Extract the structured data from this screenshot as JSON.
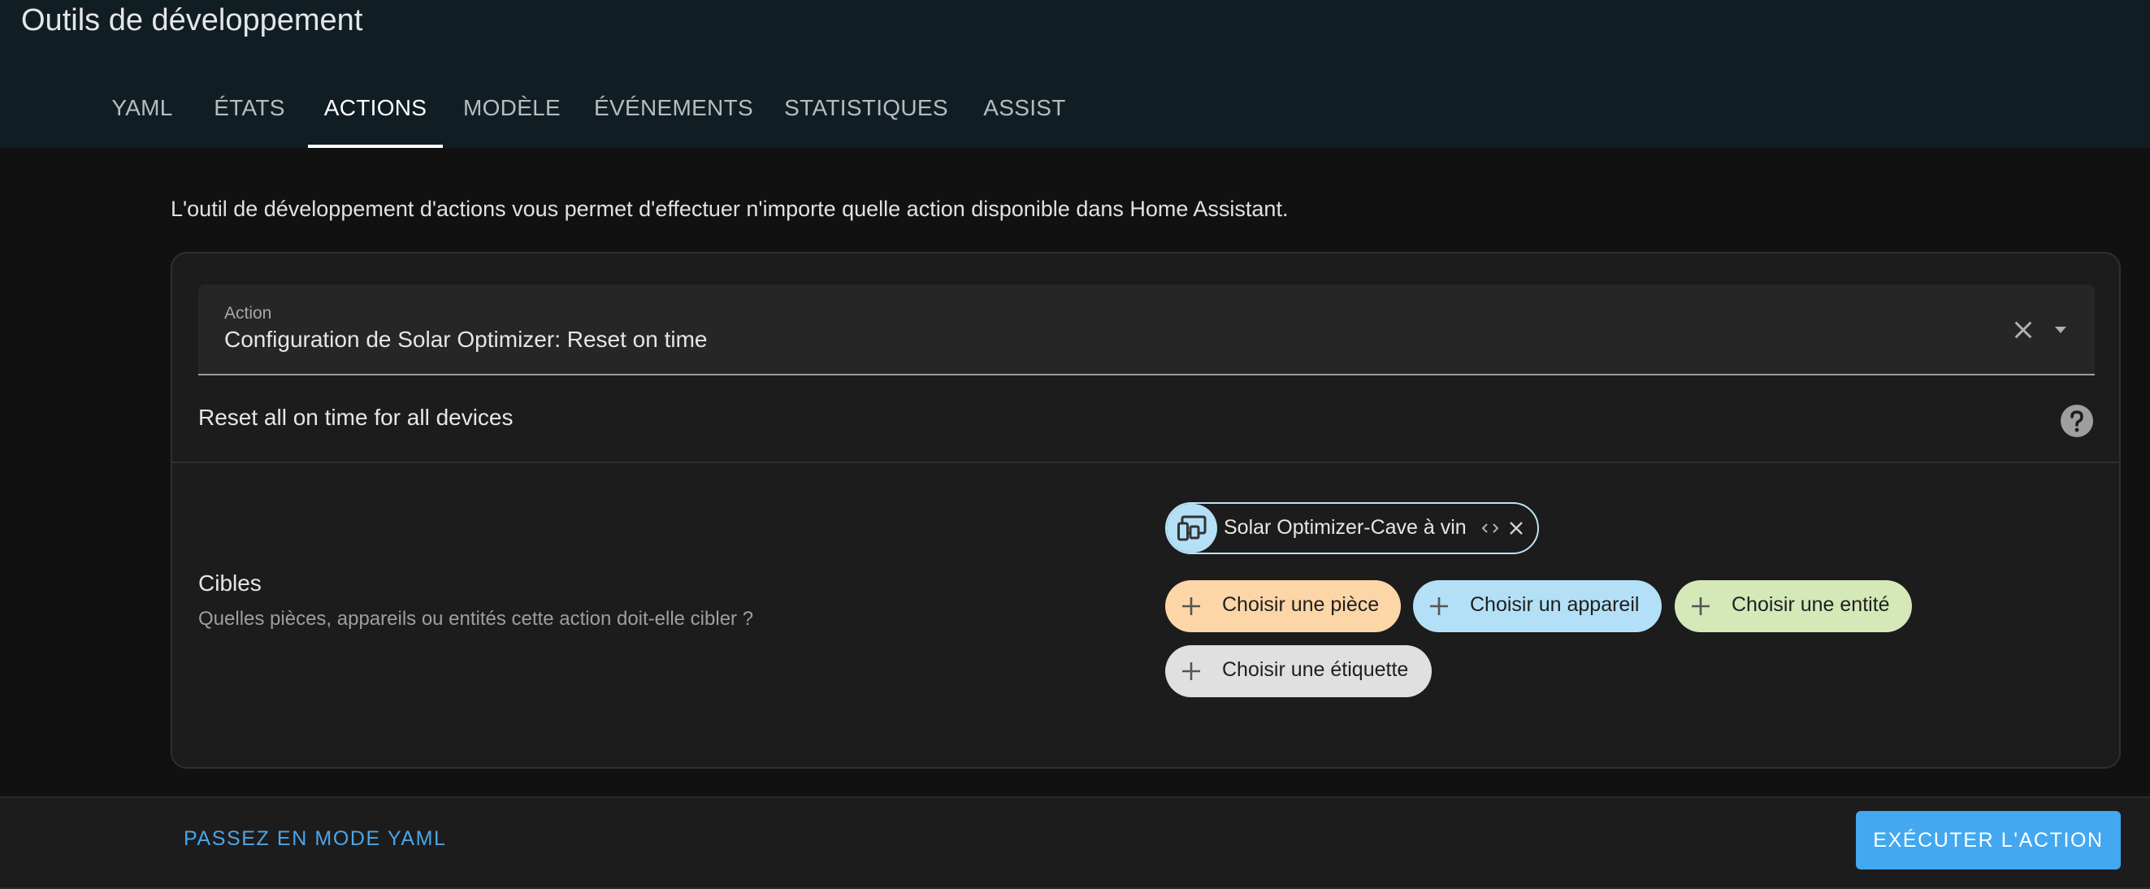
{
  "header": {
    "title": "Outils de développement",
    "tabs": [
      {
        "label": "YAML",
        "active": false
      },
      {
        "label": "ÉTATS",
        "active": false
      },
      {
        "label": "ACTIONS",
        "active": true
      },
      {
        "label": "MODÈLE",
        "active": false
      },
      {
        "label": "ÉVÉNEMENTS",
        "active": false
      },
      {
        "label": "STATISTIQUES",
        "active": false
      },
      {
        "label": "ASSIST",
        "active": false
      }
    ]
  },
  "main": {
    "description": "L'outil de développement d'actions vous permet d'effectuer n'importe quelle action disponible dans Home Assistant.",
    "action_field": {
      "label": "Action",
      "value": "Configuration de Solar Optimizer: Reset on time"
    },
    "action_description": "Reset all on time for all devices",
    "targets": {
      "title": "Cibles",
      "subtitle": "Quelles pièces, appareils ou entités cette action doit-elle cibler ?",
      "selected": [
        {
          "label": "Solar Optimizer-Cave à vin",
          "icon": "devices-icon"
        }
      ],
      "add_buttons": [
        {
          "label": "Choisir une pièce",
          "color": "#fdd6a8"
        },
        {
          "label": "Choisir un appareil",
          "color": "#b3e0f7"
        },
        {
          "label": "Choisir une entité",
          "color": "#d4e8b8"
        },
        {
          "label": "Choisir une étiquette",
          "color": "#e0e0e0"
        }
      ]
    }
  },
  "footer": {
    "yaml_mode_label": "PASSEZ EN MODE YAML",
    "execute_label": "EXÉCUTER L'ACTION"
  },
  "colors": {
    "header_bg": "#101e24",
    "accent": "#43a8f0",
    "link": "#4ca5e8"
  }
}
